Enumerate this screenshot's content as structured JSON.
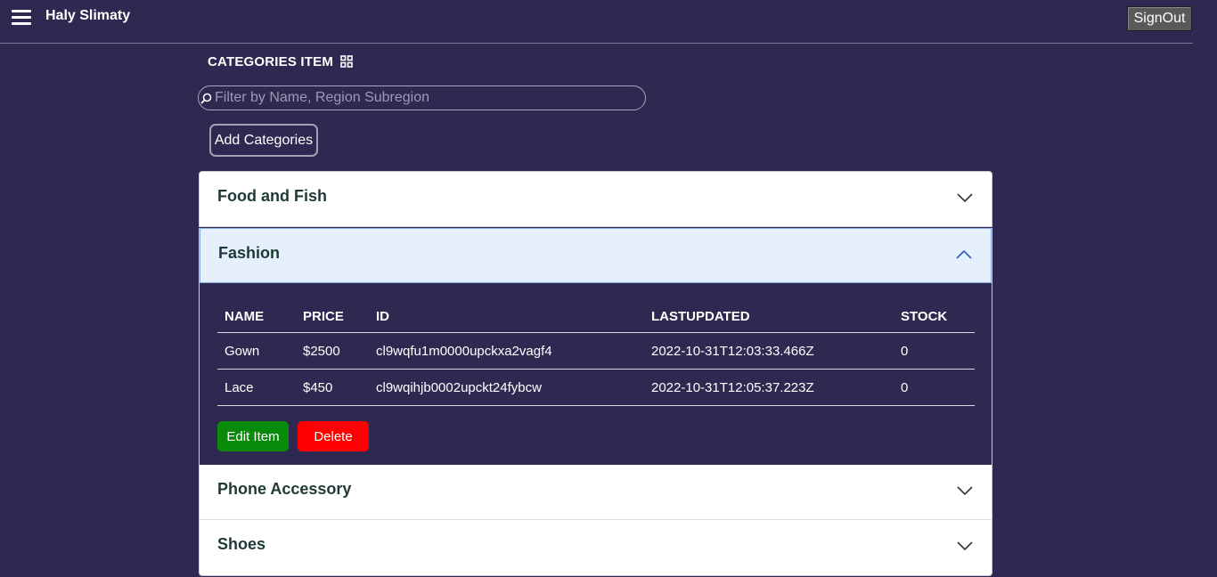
{
  "app": {
    "title": "Haly Slimaty",
    "signout_label": "SignOut"
  },
  "page": {
    "section_title": "CATEGORIES ITEM"
  },
  "search": {
    "placeholder": "Filter by Name, Region Subregion",
    "value": ""
  },
  "actions": {
    "add_label": "Add Categories"
  },
  "categories": [
    {
      "name": "Food and Fish",
      "expanded": false
    },
    {
      "name": "Fashion",
      "expanded": true
    },
    {
      "name": "Phone Accessory",
      "expanded": false
    },
    {
      "name": "Shoes",
      "expanded": false
    }
  ],
  "items_table": {
    "columns": [
      "NAME",
      "PRICE",
      "ID",
      "LASTUPDATED",
      "STOCK"
    ],
    "rows": [
      [
        "Gown",
        "$2500",
        "cl9wqfu1m0000upckxa2vagf4",
        "2022-10-31T12:03:33.466Z",
        "0"
      ],
      [
        "Lace",
        "$450",
        "cl9wqihjb0002upckt24fybcw",
        "2022-10-31T12:05:37.223Z",
        "0"
      ]
    ]
  },
  "item_actions": {
    "edit_label": "Edit Item",
    "delete_label": "Delete"
  },
  "colors": {
    "background": "#2e2950",
    "edit_button": "#0a8a0a",
    "delete_button": "#ff0000",
    "expanded_header": "#e6f0fd",
    "category_text": "#1f3a36"
  },
  "icons": {
    "menu": "hamburger-menu-icon",
    "section": "grid-icon",
    "search": "search-icon",
    "collapsed": "chevron-down-icon",
    "expanded": "chevron-up-icon"
  }
}
